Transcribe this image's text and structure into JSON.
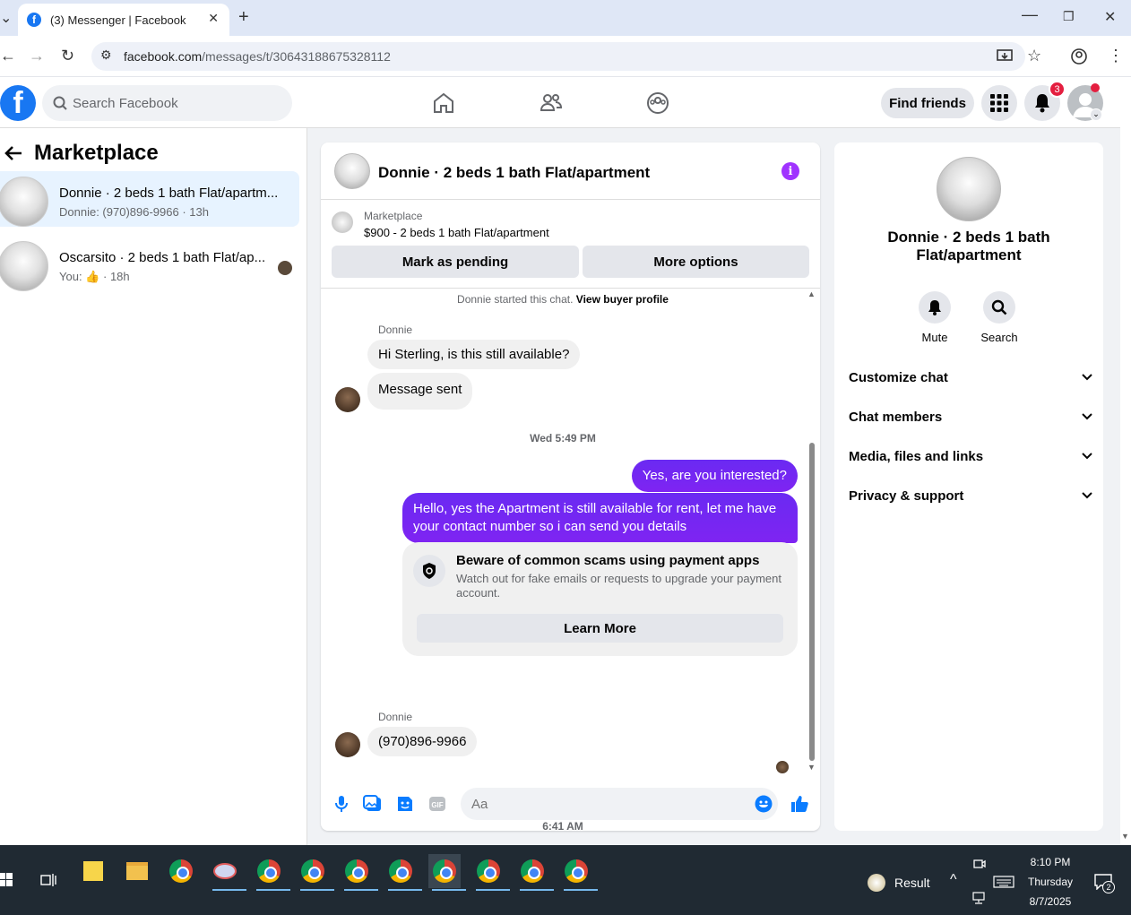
{
  "browser": {
    "tab_title": "(3) Messenger | Facebook",
    "url_host": "facebook.com",
    "url_path": "/messages/t/30643188675328112"
  },
  "fb_header": {
    "search_placeholder": "Search Facebook",
    "find_friends_label": "Find friends",
    "notification_count": "3"
  },
  "sidebar": {
    "title": "Marketplace",
    "conversations": [
      {
        "title": "Donnie · 2 beds 1 bath Flat/apartm...",
        "subtitle": "Donnie: (970)896-9966 · 13h"
      },
      {
        "title": "Oscarsito · 2 beds 1 bath Flat/ap...",
        "subtitle_prefix": "You:",
        "subtitle_suffix": "· 18h"
      }
    ]
  },
  "chat": {
    "title": "Donnie · 2 beds 1 bath Flat/apartment",
    "listing_label": "Marketplace",
    "listing_price": "$900 - 2 beds 1 bath Flat/apartment",
    "mark_pending_label": "Mark as pending",
    "more_options_label": "More options",
    "started_text": "Donnie started this chat.",
    "view_profile_label": "View buyer profile",
    "sender_name": "Donnie",
    "msg1": "Hi Sterling, is this still available?",
    "msg2": "Message sent",
    "timestamp1": "Wed 5:49 PM",
    "out_msg1": "Yes, are you interested?",
    "out_msg2": "Hello, yes the Apartment is still available for rent, let me have your contact number so i can send you details",
    "scam_title": "Beware of common scams using payment apps",
    "scam_body": "Watch out for fake emails or requests to upgrade your payment account.",
    "learn_more_label": "Learn More",
    "timestamp2": "6:41 AM",
    "sender_name2": "Donnie",
    "msg3": "(970)896-9966",
    "input_placeholder": "Aa"
  },
  "right_panel": {
    "title": "Donnie · 2 beds 1 bath Flat/apartment",
    "mute_label": "Mute",
    "search_label": "Search",
    "sections": [
      "Customize chat",
      "Chat members",
      "Media, files and links",
      "Privacy & support"
    ]
  },
  "taskbar": {
    "result_label": "Result",
    "time": "8:10 PM",
    "day": "Thursday",
    "date": "8/7/2025",
    "notif_count": "2"
  },
  "colors": {
    "fb_blue": "#1877f2",
    "messenger_purple": "#7b26f5",
    "active_conv_bg": "#e7f3ff"
  }
}
